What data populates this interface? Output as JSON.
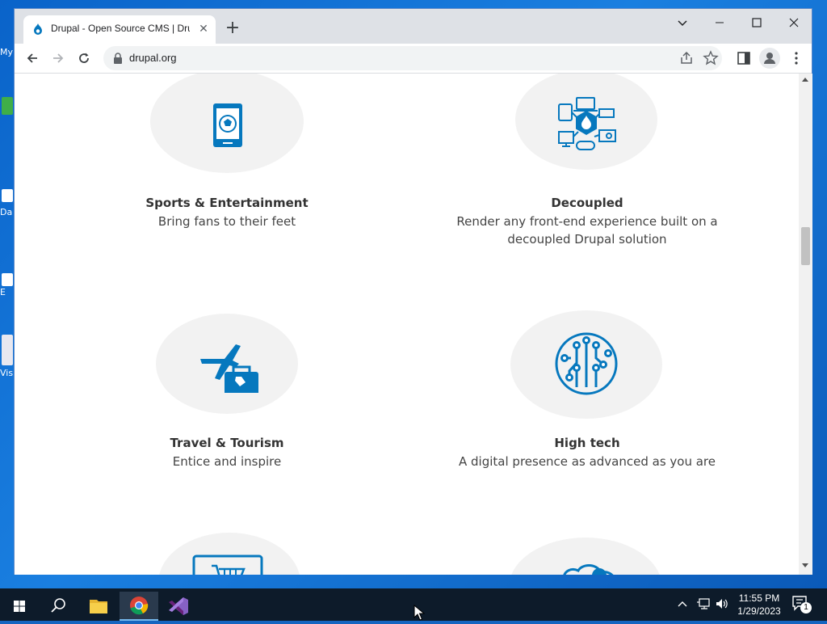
{
  "desktop": {
    "labels": [
      "My",
      "Da",
      "E",
      "Vis"
    ]
  },
  "browser": {
    "tab_title": "Drupal - Open Source CMS | Drupal.org",
    "tab_close": "✕",
    "new_tab": "+",
    "url": "drupal.org",
    "window_controls": {
      "minimize": "—",
      "maximize": "☐",
      "close": "✕",
      "tab_search": "⌄"
    }
  },
  "page": {
    "cards": [
      {
        "icon": "mobile-sports-icon",
        "title": "Sports & Entertainment",
        "desc": "Bring fans to their feet"
      },
      {
        "icon": "devices-network-icon",
        "title": "Decoupled",
        "desc": "Render any front-end experience built on a decoupled Drupal solution"
      },
      {
        "icon": "plane-suitcase-icon",
        "title": "Travel & Tourism",
        "desc": "Entice and inspire"
      },
      {
        "icon": "circuit-icon",
        "title": "High tech",
        "desc": "A digital presence as advanced as you are"
      }
    ]
  },
  "taskbar": {
    "time": "11:55 PM",
    "date": "1/29/2023",
    "notification_count": "1"
  },
  "colors": {
    "accent": "#0678be",
    "blob": "#f2f2f2"
  }
}
